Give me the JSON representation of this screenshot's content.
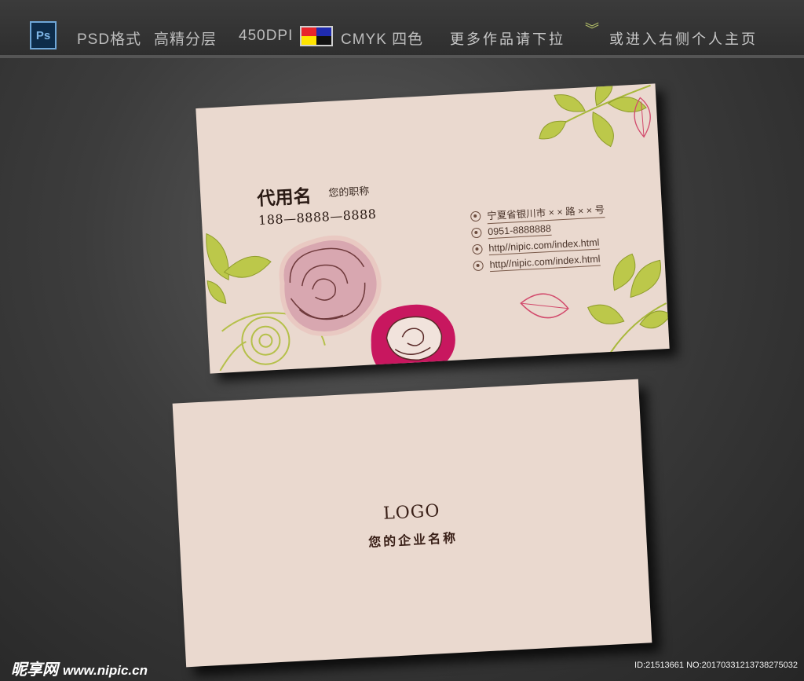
{
  "header": {
    "app_icon": "photoshop-icon",
    "app_icon_label": "Ps",
    "format": "PSD格式",
    "layers": "高精分层",
    "dpi": "450DPI",
    "color_mode": "CMYK 四色",
    "hint_left": "更多作品请下拉",
    "hint_right": "或进入右侧个人主页",
    "swatch_colors": [
      "#e8242b",
      "#1f2bb0",
      "#ffe400",
      "#111111"
    ]
  },
  "front_card": {
    "name": "代用名",
    "title": "您的职称",
    "phone": "188—8888—8888",
    "contacts": [
      {
        "icon": "location-icon",
        "text": "宁夏省银川市 × × 路 × × 号"
      },
      {
        "icon": "phone-icon",
        "text": "0951-8888888"
      },
      {
        "icon": "web-icon",
        "text": "http//nipic.com/index.html"
      },
      {
        "icon": "mail-icon",
        "text": "http//nipic.com/index.html"
      }
    ],
    "accent_colors": {
      "rose_pink": "#d4a3ac",
      "rose_magenta": "#c8175f",
      "leaf_green": "#a8b83a",
      "card_bg": "#ead9cf"
    }
  },
  "back_card": {
    "logo": "LOGO",
    "company": "您的企业名称"
  },
  "watermark": {
    "site_name": "昵享网",
    "site_url": "www.nipic.cn",
    "id_text": "ID:21513661 NO:20170331213738275032"
  }
}
